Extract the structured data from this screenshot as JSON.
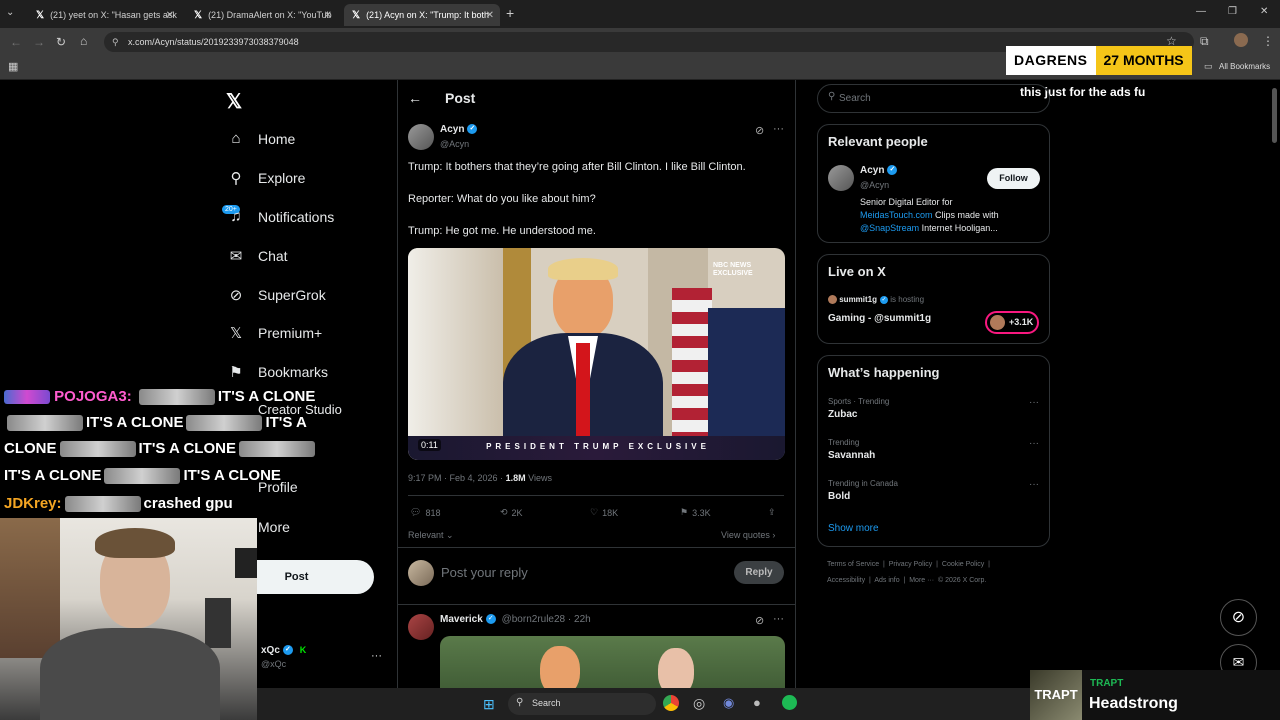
{
  "browser": {
    "tabs": [
      {
        "label": "(21) yeet on X: \"Hasan gets ask"
      },
      {
        "label": "(21) DramaAlert on X: \"YouTub"
      },
      {
        "label": "(21) Acyn on X: \"Trump: It both"
      }
    ],
    "url": "x.com/Acyn/status/2019233973038379048",
    "all_bookmarks": "All Bookmarks"
  },
  "overlay": {
    "badge_name": "DAGRENS",
    "badge_months": "27 MONTHS",
    "ads_note": "this just for the ads fu"
  },
  "nav": {
    "items": [
      {
        "label": "Home",
        "icon": "home-icon"
      },
      {
        "label": "Explore",
        "icon": "search-icon"
      },
      {
        "label": "Notifications",
        "icon": "bell-icon"
      },
      {
        "label": "Chat",
        "icon": "mail-icon"
      },
      {
        "label": "SuperGrok",
        "icon": "grok-icon"
      },
      {
        "label": "Premium+",
        "icon": "x-logo-icon"
      },
      {
        "label": "Bookmarks",
        "icon": "bookmark-icon"
      },
      {
        "label": "Creator Studio",
        "icon": "creator-icon"
      },
      {
        "label": "Profile",
        "icon": "person-icon"
      },
      {
        "label": "More",
        "icon": "more-icon"
      }
    ],
    "notif_count": "20+",
    "post_label": "Post",
    "account": {
      "name": "xQc",
      "handle": "@xQc"
    }
  },
  "post": {
    "header": "Post",
    "author": {
      "name": "Acyn",
      "handle": "@Acyn"
    },
    "text_lines": [
      "Trump: It bothers that they’re going after Bill Clinton. I like Bill Clinton.",
      "Reporter: What do you like about him?",
      "Trump: He got me. He understood me."
    ],
    "video": {
      "timestamp": "0:11",
      "banner": "PRESIDENT TRUMP EXCLUSIVE",
      "watermark": "NBC NEWS EXCLUSIVE"
    },
    "meta_time": "9:17 PM · Feb 4, 2026 ·",
    "views_count": "1.8M",
    "views_label": "Views",
    "stats": {
      "replies": "818",
      "reposts": "2K",
      "likes": "18K",
      "bookmarks": "3.3K"
    },
    "relevant": "Relevant",
    "view_quotes": "View quotes",
    "reply_placeholder": "Post your reply",
    "reply_button": "Reply"
  },
  "reply_post": {
    "name": "Maverick",
    "handle_time": "@born2rule28 · 22h"
  },
  "sidebar": {
    "search_placeholder": "Search",
    "relevant_people": {
      "title": "Relevant people",
      "name": "Acyn",
      "handle": "@Acyn",
      "follow": "Follow",
      "bio_1": "Senior Digital Editor for",
      "bio_link1": "MeidasTouch.com",
      "bio_2": " Clips made with",
      "bio_link2": "@SnapStream",
      "bio_3": " Internet Hooligan..."
    },
    "live": {
      "title": "Live on X",
      "host": "summit1g",
      "hosting": "is hosting",
      "stream": "Gaming - @summit1g",
      "viewers": "+3.1K"
    },
    "happening": {
      "title": "What’s happening",
      "trends": [
        {
          "label": "Sports · Trending",
          "name": "Zubac"
        },
        {
          "label": "Trending",
          "name": "Savannah"
        },
        {
          "label": "Trending in Canada",
          "name": "Bold"
        }
      ],
      "show_more": "Show more"
    },
    "footer_1": "Terms of Service  |  Privacy Policy  |  Cookie Policy  |",
    "footer_2": "Accessibility  |  Ads info  |  More ···  © 2026 X Corp."
  },
  "chat": {
    "line1_user": "POJOGA3:",
    "clone": "IT'S A CLONE",
    "its_a": "IT'S A",
    "clone_word": "CLONE",
    "user2": "JDKrey:",
    "msg2": "crashed gpu"
  },
  "taskbar": {
    "search": "Search"
  },
  "nowplaying": {
    "artist": "TRAPT",
    "song": "Headstrong",
    "art_text": "TRAPT"
  }
}
